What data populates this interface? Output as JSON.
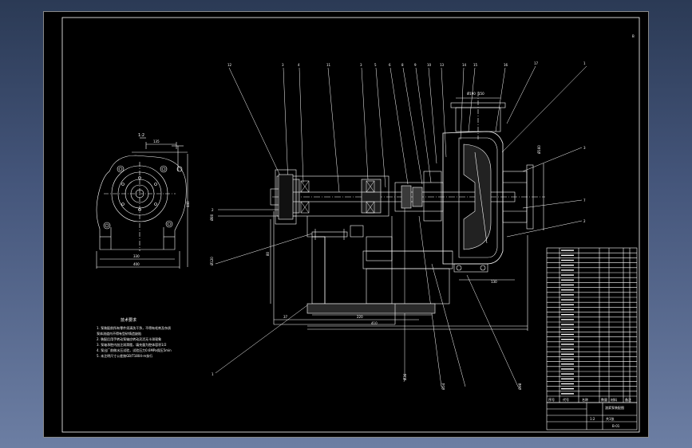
{
  "sheet": {
    "corner_mark": "B"
  },
  "side_view": {
    "label": "1:2",
    "dims": [
      "135",
      "440",
      "330",
      "400"
    ]
  },
  "section_view": {
    "balloons": [
      "12",
      "3",
      "4",
      "11",
      "3",
      "5",
      "6",
      "8",
      "9",
      "10",
      "13",
      "14",
      "15",
      "16",
      "17",
      "1",
      "3",
      "7",
      "2",
      "2",
      "1",
      "7"
    ],
    "dims": [
      "37",
      "220",
      "410",
      "80",
      "130",
      "150",
      "Ø190",
      "Ø160",
      "Ø80",
      "Ø120",
      "Ø36",
      "Ø54",
      "Ø98"
    ]
  },
  "notes": {
    "title": "技术要求",
    "lines": [
      "1. 泵装配前所有零件须清洗干净，不得有毛刺及杂质",
      "   泵体流道内不得有型砂铸造缺陷",
      "2. 装配后用手转动泵轴应转动灵活无卡滞现象",
      "3. 泵轴承腔内加注润滑脂，填充量为腔体容积1/2",
      "4. 泵出厂前做水压试验，试验压力0.6MPa保压5min",
      "5. 未注明尺寸公差按GB/T1804-m执行"
    ]
  },
  "parts_table": {
    "rows": 30,
    "header": [
      "序号",
      "代号",
      "名称",
      "数量",
      "材料",
      "备注"
    ]
  },
  "title_block": {
    "name": "渣浆泵装配图",
    "scale": "1:2",
    "sheet": "共1张",
    "drawing_no": "B-01"
  }
}
